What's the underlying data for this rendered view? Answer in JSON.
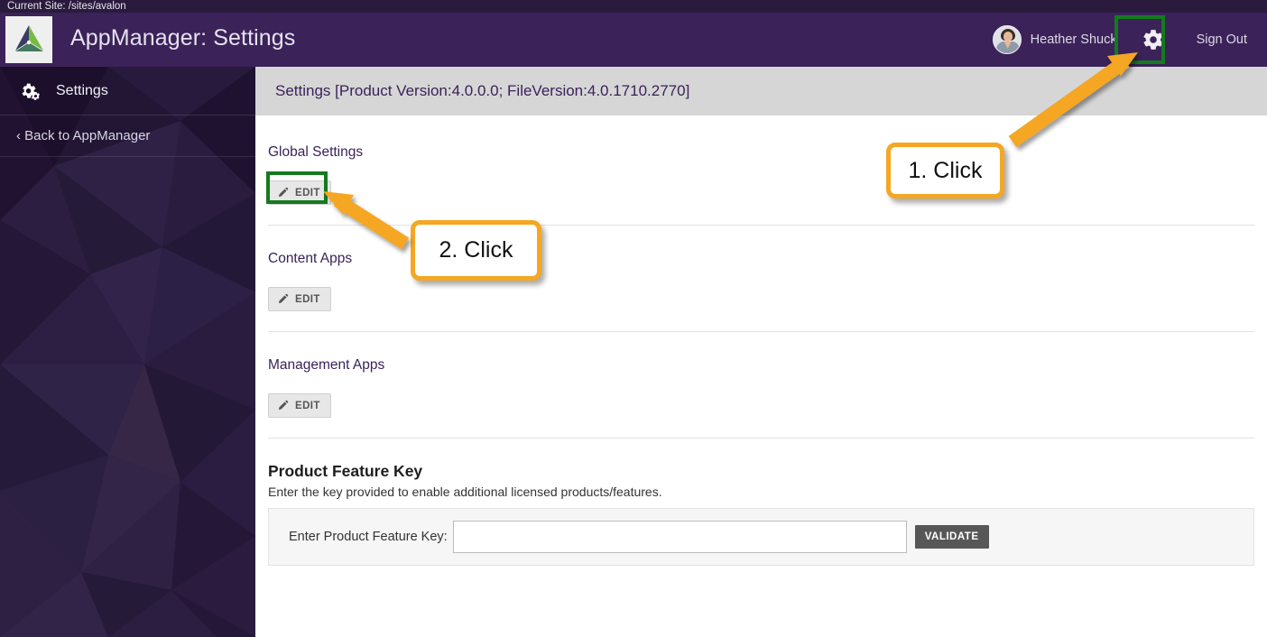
{
  "site_bar": {
    "text": "Current Site: /sites/avalon"
  },
  "header": {
    "app_title": "AppManager: Settings",
    "logo_icon": "pyramid-logo-icon",
    "user_name": "Heather Shuck",
    "avatar_icon": "user-avatar",
    "gear_icon": "gear-icon",
    "sign_out_label": "Sign Out",
    "bg_color": "#3b2259"
  },
  "sidebar": {
    "header": {
      "label": "Settings",
      "icon": "gears-icon"
    },
    "links": [
      {
        "label": "‹ Back to AppManager"
      }
    ],
    "bg_color": "#241636"
  },
  "content": {
    "head_title": "Settings [Product Version:4.0.0.0; FileVersion:4.0.1710.2770]",
    "sections": [
      {
        "title": "Global Settings",
        "edit_label": "EDIT",
        "edit_icon": "pencil-icon"
      },
      {
        "title": "Content Apps",
        "edit_label": "EDIT",
        "edit_icon": "pencil-icon"
      },
      {
        "title": "Management Apps",
        "edit_label": "EDIT",
        "edit_icon": "pencil-icon"
      }
    ],
    "product_feature_key": {
      "title": "Product Feature Key",
      "description": "Enter the key provided to enable additional licensed products/features.",
      "field_label": "Enter Product Feature Key:",
      "field_value": "",
      "field_placeholder": "",
      "validate_label": "VALIDATE"
    }
  },
  "annotations": {
    "highlight_color": "#157a1f",
    "callout_color": "#f5a623",
    "callouts": [
      {
        "label": "1. Click",
        "target": "gear-icon"
      },
      {
        "label": "2. Click",
        "target": "global-settings-edit-button"
      }
    ]
  }
}
